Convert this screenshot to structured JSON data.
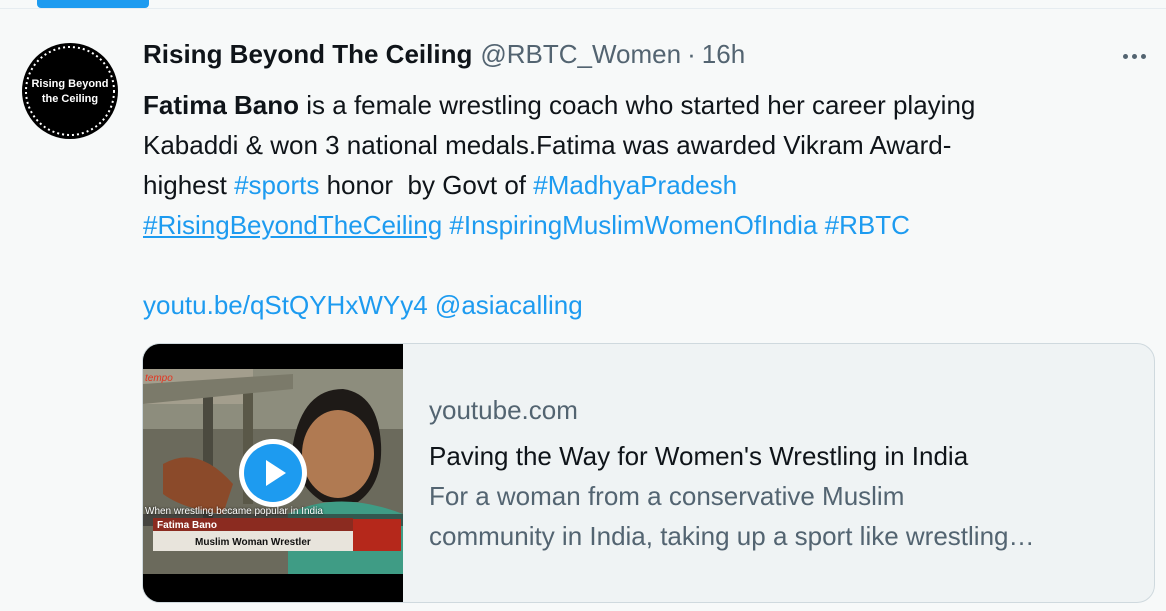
{
  "tweet": {
    "avatar": {
      "line1": "Rising Beyond",
      "line2": "the Ceiling",
      "colors": {
        "bg": "#000000",
        "ring": "#ffffff"
      }
    },
    "display_name": "Rising Beyond The Ceiling",
    "handle": "@RBTC_Women",
    "separator": "·",
    "time": "16h",
    "more_icon": "more-horizontal-icon",
    "text": {
      "line1_bold": "Fatima Bano",
      "line1_rest": " is a female wrestling coach who started her career playing",
      "line2": "Kabaddi & won 3 national medals.Fatima was awarded Vikram Award-",
      "line3_a": "highest ",
      "line3_tag_sports": "#sports",
      "line3_b": " honor  by Govt of ",
      "line3_tag_mp": "#MadhyaPradesh",
      "line4_tag_rbtc_long": "#RisingBeyondTheCeiling",
      "line4_tag_inspiring": "#InspiringMuslimWomenOfIndia",
      "line4_tag_rbtc": "#RBTC",
      "link_url": "youtu.be/qStQYHxWYy4",
      "mention": "@asiacalling"
    },
    "card": {
      "domain": "youtube.com",
      "title": "Paving the Way for Women's Wrestling in India",
      "desc_line1": "For a woman from a conservative Muslim",
      "desc_line2": "community in India, taking up a sport like wrestling…",
      "thumbnail": {
        "logo": "tempo",
        "caption": "When wrestling became popular in India",
        "name": "Fatima Bano",
        "role": "Muslim Woman Wrestler",
        "play_icon": "play-icon"
      }
    }
  },
  "colors": {
    "accent": "#1d9bf0",
    "text": "#0f1419",
    "muted": "#536471",
    "background": "#f7f9f9"
  }
}
